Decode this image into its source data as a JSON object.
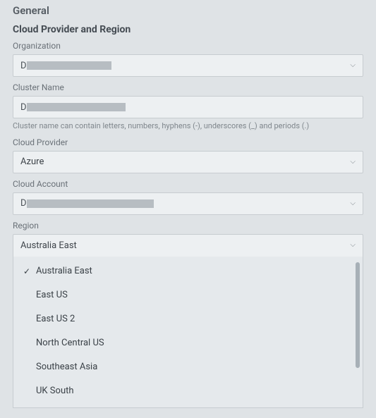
{
  "page": {
    "title": "General"
  },
  "section": {
    "title": "Cloud Provider and Region"
  },
  "fields": {
    "organization": {
      "label": "Organization",
      "prefix": "D",
      "redacted_width": 120
    },
    "cluster_name": {
      "label": "Cluster Name",
      "prefix": "D",
      "redacted_width": 140,
      "helper": "Cluster name can contain letters, numbers, hyphens (-), underscores (_) and periods (.)"
    },
    "cloud_provider": {
      "label": "Cloud Provider",
      "value": "Azure"
    },
    "cloud_account": {
      "label": "Cloud Account",
      "prefix": "D",
      "redacted_width": 180
    },
    "region": {
      "label": "Region",
      "value": "Australia East",
      "options": [
        {
          "label": "Australia East",
          "selected": true
        },
        {
          "label": "East US",
          "selected": false
        },
        {
          "label": "East US 2",
          "selected": false
        },
        {
          "label": "North Central US",
          "selected": false
        },
        {
          "label": "Southeast Asia",
          "selected": false
        },
        {
          "label": "UK South",
          "selected": false
        }
      ]
    }
  }
}
